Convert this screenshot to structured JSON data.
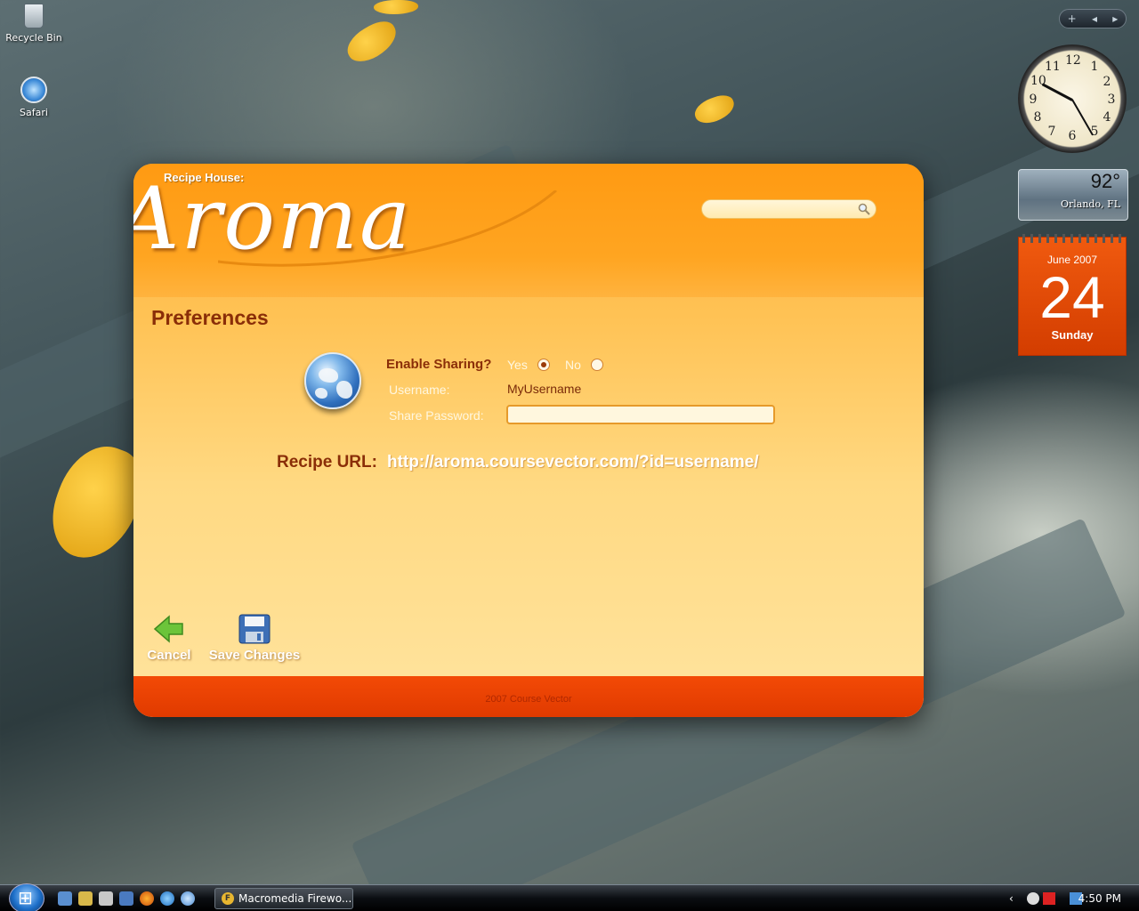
{
  "desktop": {
    "icons": [
      {
        "label": "Recycle Bin",
        "icon": "recycle-bin-icon"
      },
      {
        "label": "Safari",
        "icon": "safari-icon"
      }
    ]
  },
  "gadgets": {
    "clock": {
      "numerals": [
        "12",
        "1",
        "2",
        "3",
        "4",
        "5",
        "6",
        "7",
        "8",
        "9",
        "10",
        "11"
      ],
      "time": "4:50"
    },
    "weather": {
      "temperature": "92°",
      "city": "Orlando, FL"
    },
    "calendar": {
      "month": "June 2007",
      "day": "24",
      "weekday": "Sunday"
    }
  },
  "app": {
    "brand_small": "Recipe House:",
    "brand_logo": "Aroma",
    "search": {
      "value": "",
      "placeholder": ""
    },
    "page_title": "Preferences",
    "sharing": {
      "label": "Enable Sharing?",
      "options": [
        {
          "label": "Yes",
          "checked": true
        },
        {
          "label": "No",
          "checked": false
        }
      ]
    },
    "username_label": "Username:",
    "username_value": "MyUsername",
    "password_label": "Share Password:",
    "password_value": "",
    "url_label": "Recipe URL:",
    "url_value": "http://aroma.coursevector.com/?id=username/",
    "actions": {
      "cancel": "Cancel",
      "save": "Save Changes"
    },
    "footer": "2007 Course Vector",
    "colors": {
      "accent": "#ff9a12",
      "title": "#8a2e08",
      "footer": "#f34a06"
    }
  },
  "taskbar": {
    "task_label": "Macromedia Firewo...",
    "clock": "4:50 PM"
  }
}
